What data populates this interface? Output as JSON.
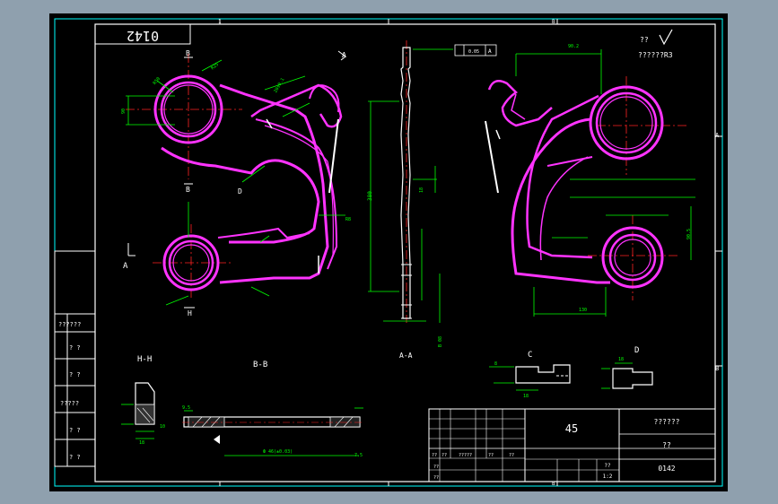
{
  "drawing": {
    "number": "0142",
    "number_mirrored": "0142",
    "material": "45",
    "title_block": {
      "part_name_placeholder": "??????",
      "unit_placeholder": "??",
      "drawing_no": "0142",
      "ratio": "1:2",
      "sheet_label": "??",
      "rows": [
        "??",
        "??",
        "?????",
        "??",
        "??",
        "??",
        "??"
      ]
    },
    "left_columns": {
      "cells": [
        "??????",
        "? ?",
        "? ?",
        "?????",
        "? ?",
        "? ?"
      ]
    },
    "roughness": {
      "label": "??",
      "value": "??????R3"
    },
    "section_labels": {
      "hh": "H-H",
      "bb": "B-B",
      "aa": "A-A",
      "c": "C",
      "d": "D",
      "a_top": "A",
      "a_right": "A",
      "a_left": "A",
      "b_top": "B",
      "b_bottom": "B",
      "h_bottom": "H",
      "d_mark": "D"
    },
    "frame_zones": {
      "top_left": "1",
      "top_mid": "B",
      "bottom_mid": "B",
      "right_a": "A",
      "right_b": "B"
    },
    "dims": {
      "d380": "380",
      "d18": "18",
      "dim_b2": "B 08",
      "dim_c1": "8",
      "d10": "10",
      "d75": "7.5",
      "d95": "9.5",
      "d40": "40",
      "d130": "130"
    },
    "colors": {
      "background": "#000000",
      "part": "#ff33ff",
      "dimension": "#00ff00",
      "frame": "#ffffff",
      "frame_cyan": "#00ffff",
      "center": "#ff0000"
    }
  }
}
